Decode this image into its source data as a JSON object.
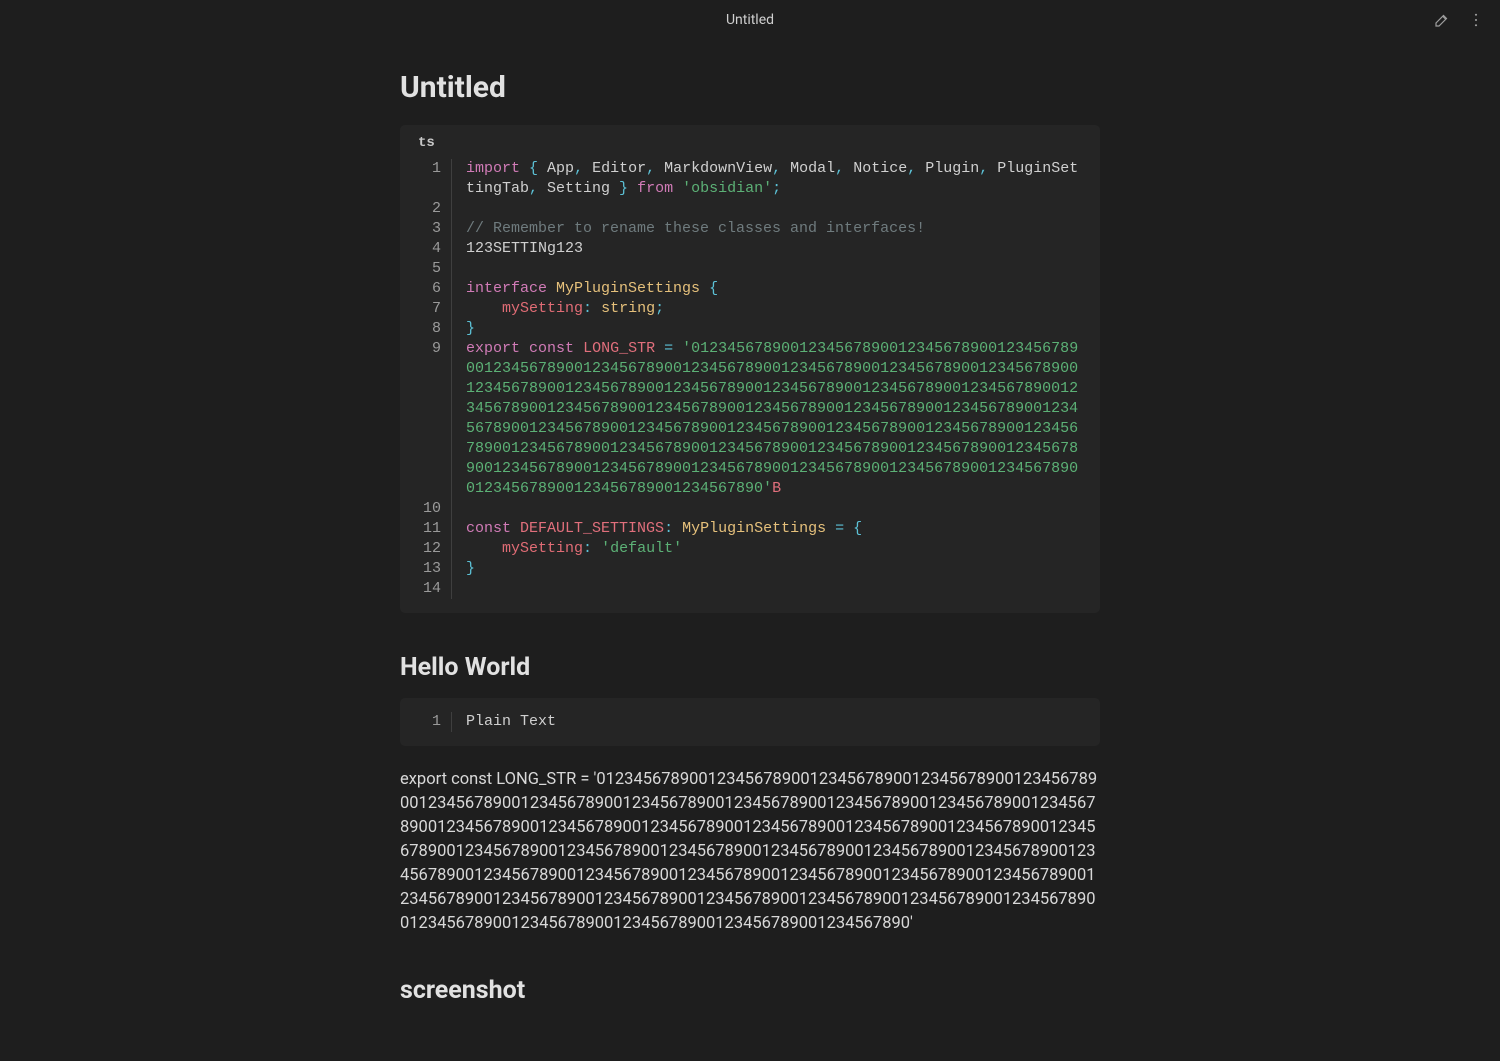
{
  "titlebar": {
    "title": "Untitled"
  },
  "page_title": "Untitled",
  "block1": {
    "lang": "ts",
    "line_numbers": [
      "1",
      "2",
      "3",
      "4",
      "5",
      "6",
      "7",
      "8",
      "9",
      "10",
      "11",
      "12",
      "13",
      "14"
    ],
    "lines": [
      [
        {
          "c": "kw",
          "t": "import"
        },
        {
          "c": "plain",
          "t": " "
        },
        {
          "c": "op",
          "t": "{"
        },
        {
          "c": "plain",
          "t": " App"
        },
        {
          "c": "op",
          "t": ","
        },
        {
          "c": "plain",
          "t": " Editor"
        },
        {
          "c": "op",
          "t": ","
        },
        {
          "c": "plain",
          "t": " MarkdownView"
        },
        {
          "c": "op",
          "t": ","
        },
        {
          "c": "plain",
          "t": " Modal"
        },
        {
          "c": "op",
          "t": ","
        },
        {
          "c": "plain",
          "t": " Notice"
        },
        {
          "c": "op",
          "t": ","
        },
        {
          "c": "plain",
          "t": " Plugin"
        },
        {
          "c": "op",
          "t": ","
        },
        {
          "c": "plain",
          "t": " PluginSettingTab"
        },
        {
          "c": "op",
          "t": ","
        },
        {
          "c": "plain",
          "t": " Setting "
        },
        {
          "c": "op",
          "t": "}"
        },
        {
          "c": "plain",
          "t": " "
        },
        {
          "c": "kw",
          "t": "from"
        },
        {
          "c": "plain",
          "t": " "
        },
        {
          "c": "str",
          "t": "'obsidian'"
        },
        {
          "c": "op",
          "t": ";"
        }
      ],
      [],
      [
        {
          "c": "comment",
          "t": "// Remember to rename these classes and interfaces!"
        }
      ],
      [
        {
          "c": "plain",
          "t": "123SETTINg123"
        }
      ],
      [],
      [
        {
          "c": "kw",
          "t": "interface"
        },
        {
          "c": "plain",
          "t": " "
        },
        {
          "c": "type",
          "t": "MyPluginSettings"
        },
        {
          "c": "plain",
          "t": " "
        },
        {
          "c": "op",
          "t": "{"
        }
      ],
      [
        {
          "c": "plain",
          "t": "    "
        },
        {
          "c": "ident",
          "t": "mySetting"
        },
        {
          "c": "op",
          "t": ":"
        },
        {
          "c": "plain",
          "t": " "
        },
        {
          "c": "type",
          "t": "string"
        },
        {
          "c": "op",
          "t": ";"
        }
      ],
      [
        {
          "c": "op",
          "t": "}"
        }
      ],
      [
        {
          "c": "kw",
          "t": "export"
        },
        {
          "c": "plain",
          "t": " "
        },
        {
          "c": "kw",
          "t": "const"
        },
        {
          "c": "plain",
          "t": " "
        },
        {
          "c": "const",
          "t": "LONG_STR"
        },
        {
          "c": "plain",
          "t": " "
        },
        {
          "c": "op",
          "t": "="
        },
        {
          "c": "plain",
          "t": " "
        },
        {
          "c": "str",
          "t": "'0123456789001234567890012345678900123456789001234567890012345678900123456789001234567890012345678900123456789001234567890012345678900123456789001234567890012345678900123456789001234567890012345678900123456789001234567890012345678900123456789001234567890012345678900123456789001234567890012345678900123456789001234567890012345678900123456789001234567890012345678900123456789001234567890012345678900123456789001234567890012345678900123456789001234567890012345678900123456789001234567890'"
        },
        {
          "c": "const",
          "t": "B"
        }
      ],
      [],
      [
        {
          "c": "kw",
          "t": "const"
        },
        {
          "c": "plain",
          "t": " "
        },
        {
          "c": "const",
          "t": "DEFAULT_SETTINGS"
        },
        {
          "c": "op",
          "t": ":"
        },
        {
          "c": "plain",
          "t": " "
        },
        {
          "c": "type",
          "t": "MyPluginSettings"
        },
        {
          "c": "plain",
          "t": " "
        },
        {
          "c": "op",
          "t": "="
        },
        {
          "c": "plain",
          "t": " "
        },
        {
          "c": "op",
          "t": "{"
        }
      ],
      [
        {
          "c": "plain",
          "t": "    "
        },
        {
          "c": "ident",
          "t": "mySetting"
        },
        {
          "c": "op",
          "t": ":"
        },
        {
          "c": "plain",
          "t": " "
        },
        {
          "c": "str",
          "t": "'default'"
        }
      ],
      [
        {
          "c": "op",
          "t": "}"
        }
      ],
      []
    ]
  },
  "h2_hello": "Hello World",
  "block2": {
    "line_numbers": [
      "1"
    ],
    "lines": [
      [
        {
          "c": "plain",
          "t": "Plain Text"
        }
      ]
    ]
  },
  "paragraph": "export const LONG_STR = '0123456789001234567890012345678900123456789001234567890012345678900123456789001234567890012345678900123456789001234567890012345678900123456789001234567890012345678900123456789001234567890012345678900123456789001234567890012345678900123456789001234567890012345678900123456789001234567890012345678900123456789001234567890012345678900123456789001234567890012345678900123456789001234567890012345678900123456789001234567890012345678900123456789001234567890012345678900123456789001234567890'",
  "h2_screenshot": "screenshot"
}
